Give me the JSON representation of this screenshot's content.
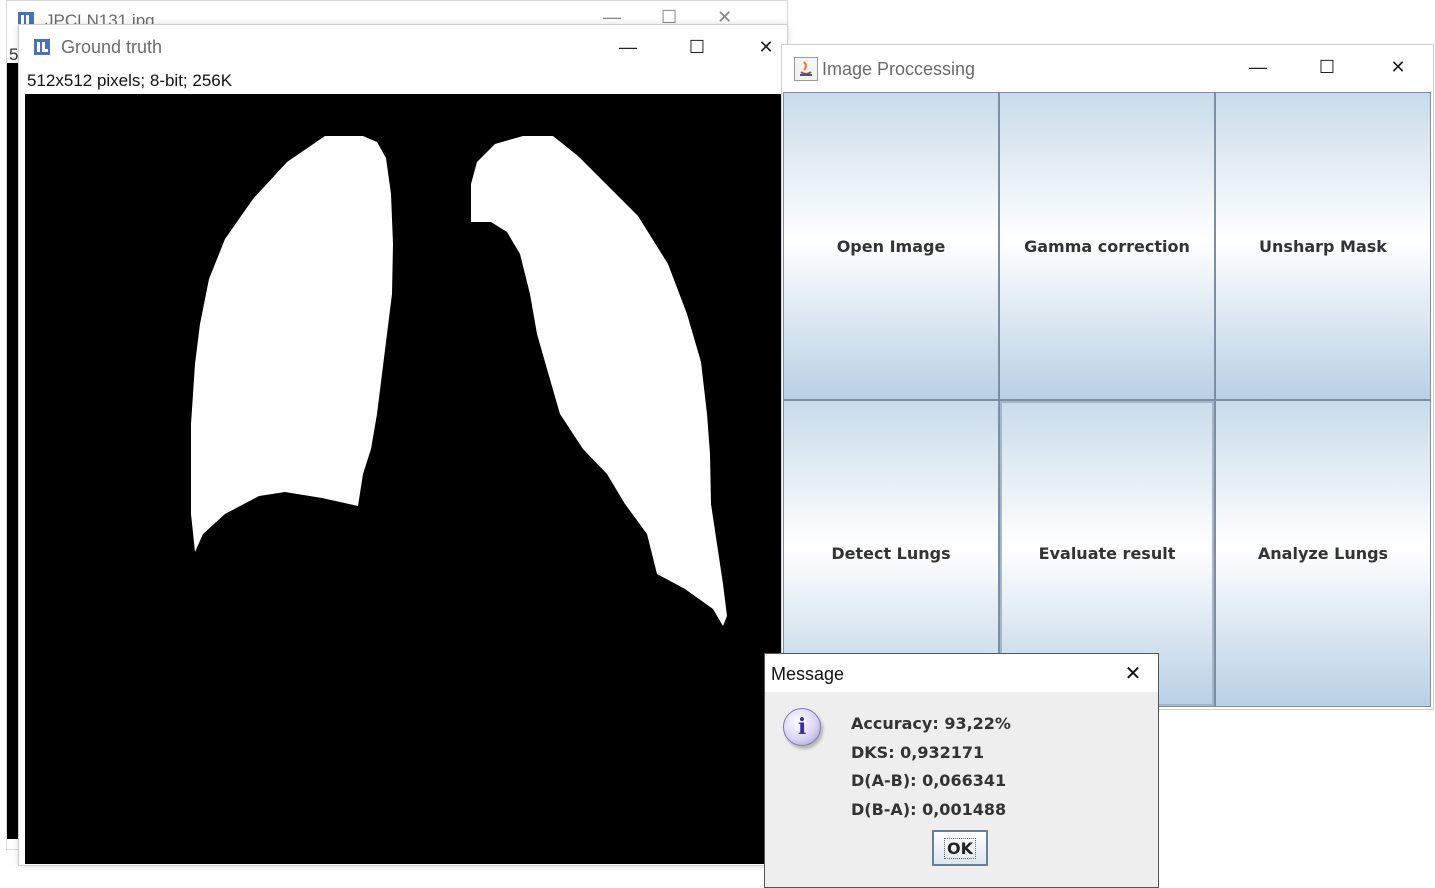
{
  "back_window": {
    "title": "JPCLN131.jpg",
    "partial_info": "5",
    "minimize": "—",
    "maximize": "☐",
    "close": "✕"
  },
  "ground_truth_window": {
    "title": "Ground truth",
    "info": "512x512 pixels; 8-bit; 256K",
    "minimize": "—",
    "maximize": "☐",
    "close": "✕",
    "icon": "imagej-icon"
  },
  "image_processing_window": {
    "title": "Image Proccessing",
    "icon": "java-icon",
    "minimize": "—",
    "maximize": "☐",
    "close": "✕",
    "buttons": [
      {
        "label": "Open Image"
      },
      {
        "label": "Gamma correction"
      },
      {
        "label": "Unsharp Mask"
      },
      {
        "label": "Detect Lungs"
      },
      {
        "label": "Evaluate result"
      },
      {
        "label": "Analyze Lungs"
      }
    ]
  },
  "message_dialog": {
    "title": "Message",
    "close": "✕",
    "icon_glyph": "i",
    "lines": [
      "Accuracy: 93,22%",
      "DKS: 0,932171",
      "D(A-B): 0,066341",
      "D(B-A): 0,001488"
    ],
    "ok_label": "OK"
  },
  "colors": {
    "mask_background": "#000000",
    "mask_foreground": "#ffffff",
    "button_gradient_top": "#c9dbea",
    "button_gradient_mid": "#ffffff",
    "button_border": "#7d8ea0"
  }
}
